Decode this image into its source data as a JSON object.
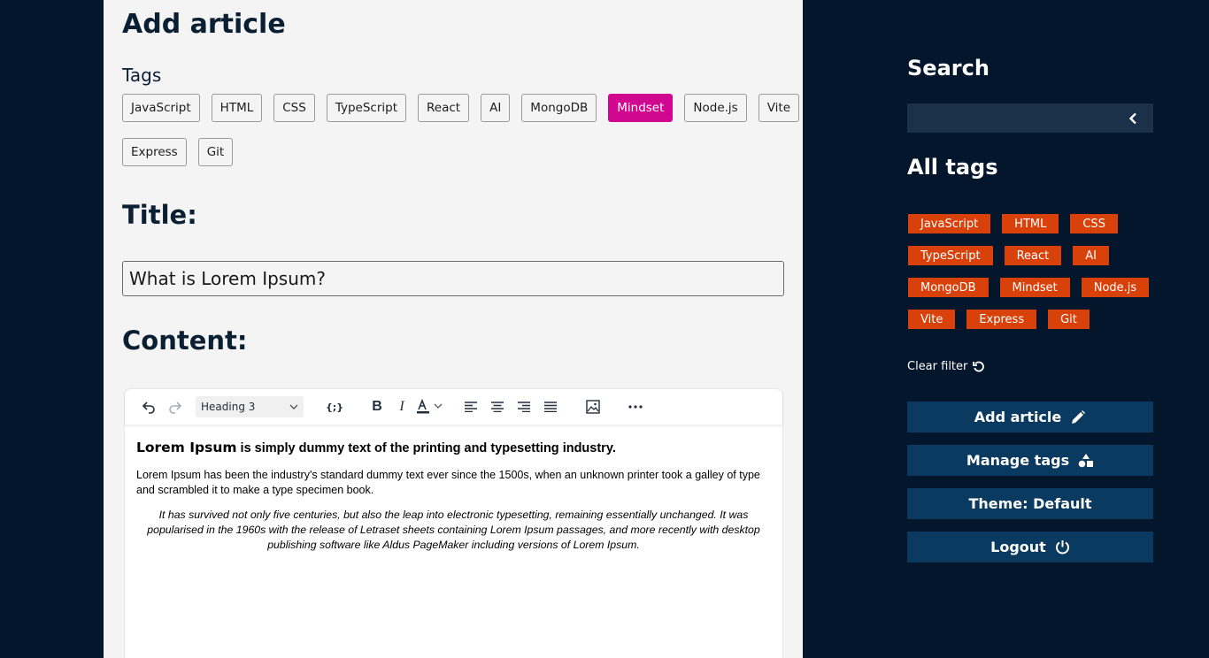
{
  "main": {
    "page_title": "Add article",
    "tags_label": "Tags",
    "tags_row1": [
      "JavaScript",
      "HTML",
      "CSS",
      "TypeScript",
      "React",
      "AI",
      "MongoDB",
      "Mindset",
      "Node.js",
      "Vite"
    ],
    "tags_row2": [
      "Express",
      "Git"
    ],
    "active_tag": "Mindset",
    "title_label": "Title:",
    "title_value": "What is Lorem Ipsum?",
    "content_label": "Content:"
  },
  "editor": {
    "block_format": "Heading 3",
    "heading_bold_lead": "Lorem Ipsum",
    "heading_rest": " is simply dummy text of the printing and typesetting industry.",
    "paragraph": "Lorem Ipsum has been the industry's standard dummy text ever since the 1500s, when an unknown printer took a galley of type and scrambled it to make a type specimen book.",
    "quote": "It has survived not only five centuries, but also the leap into electronic typesetting, remaining essentially unchanged. It was popularised in the 1960s with the release of Letraset sheets containing Lorem Ipsum passages, and more recently with desktop publishing software like Aldus PageMaker including versions of Lorem Ipsum."
  },
  "sidebar": {
    "search_title": "Search",
    "search_value": "",
    "all_tags_title": "All tags",
    "tag_rows": [
      [
        "JavaScript",
        "HTML",
        "CSS"
      ],
      [
        "TypeScript",
        "React",
        "AI"
      ],
      [
        "MongoDB",
        "Mindset",
        "Node.js"
      ],
      [
        "Vite",
        "Express",
        "Git"
      ]
    ],
    "clear_filter": "Clear filter",
    "add_article": "Add article",
    "manage_tags": "Manage tags",
    "theme": "Theme: Default",
    "logout": "Logout"
  },
  "colors": {
    "background": "#03162b",
    "panel": "#f4f4f4",
    "active_tag": "#d1078f",
    "sidebar_tag": "#d9410a",
    "sidebar_button": "#0a3a5f",
    "search_box": "#1b3049"
  },
  "icons": [
    "undo-icon",
    "redo-icon",
    "code-icon",
    "bold-icon",
    "italic-icon",
    "text-color-icon",
    "align-left-icon",
    "align-center-icon",
    "align-right-icon",
    "justify-icon",
    "image-icon",
    "more-icon",
    "chevron-left-icon",
    "refresh-icon",
    "pencil-icon",
    "shapes-icon",
    "power-icon"
  ]
}
